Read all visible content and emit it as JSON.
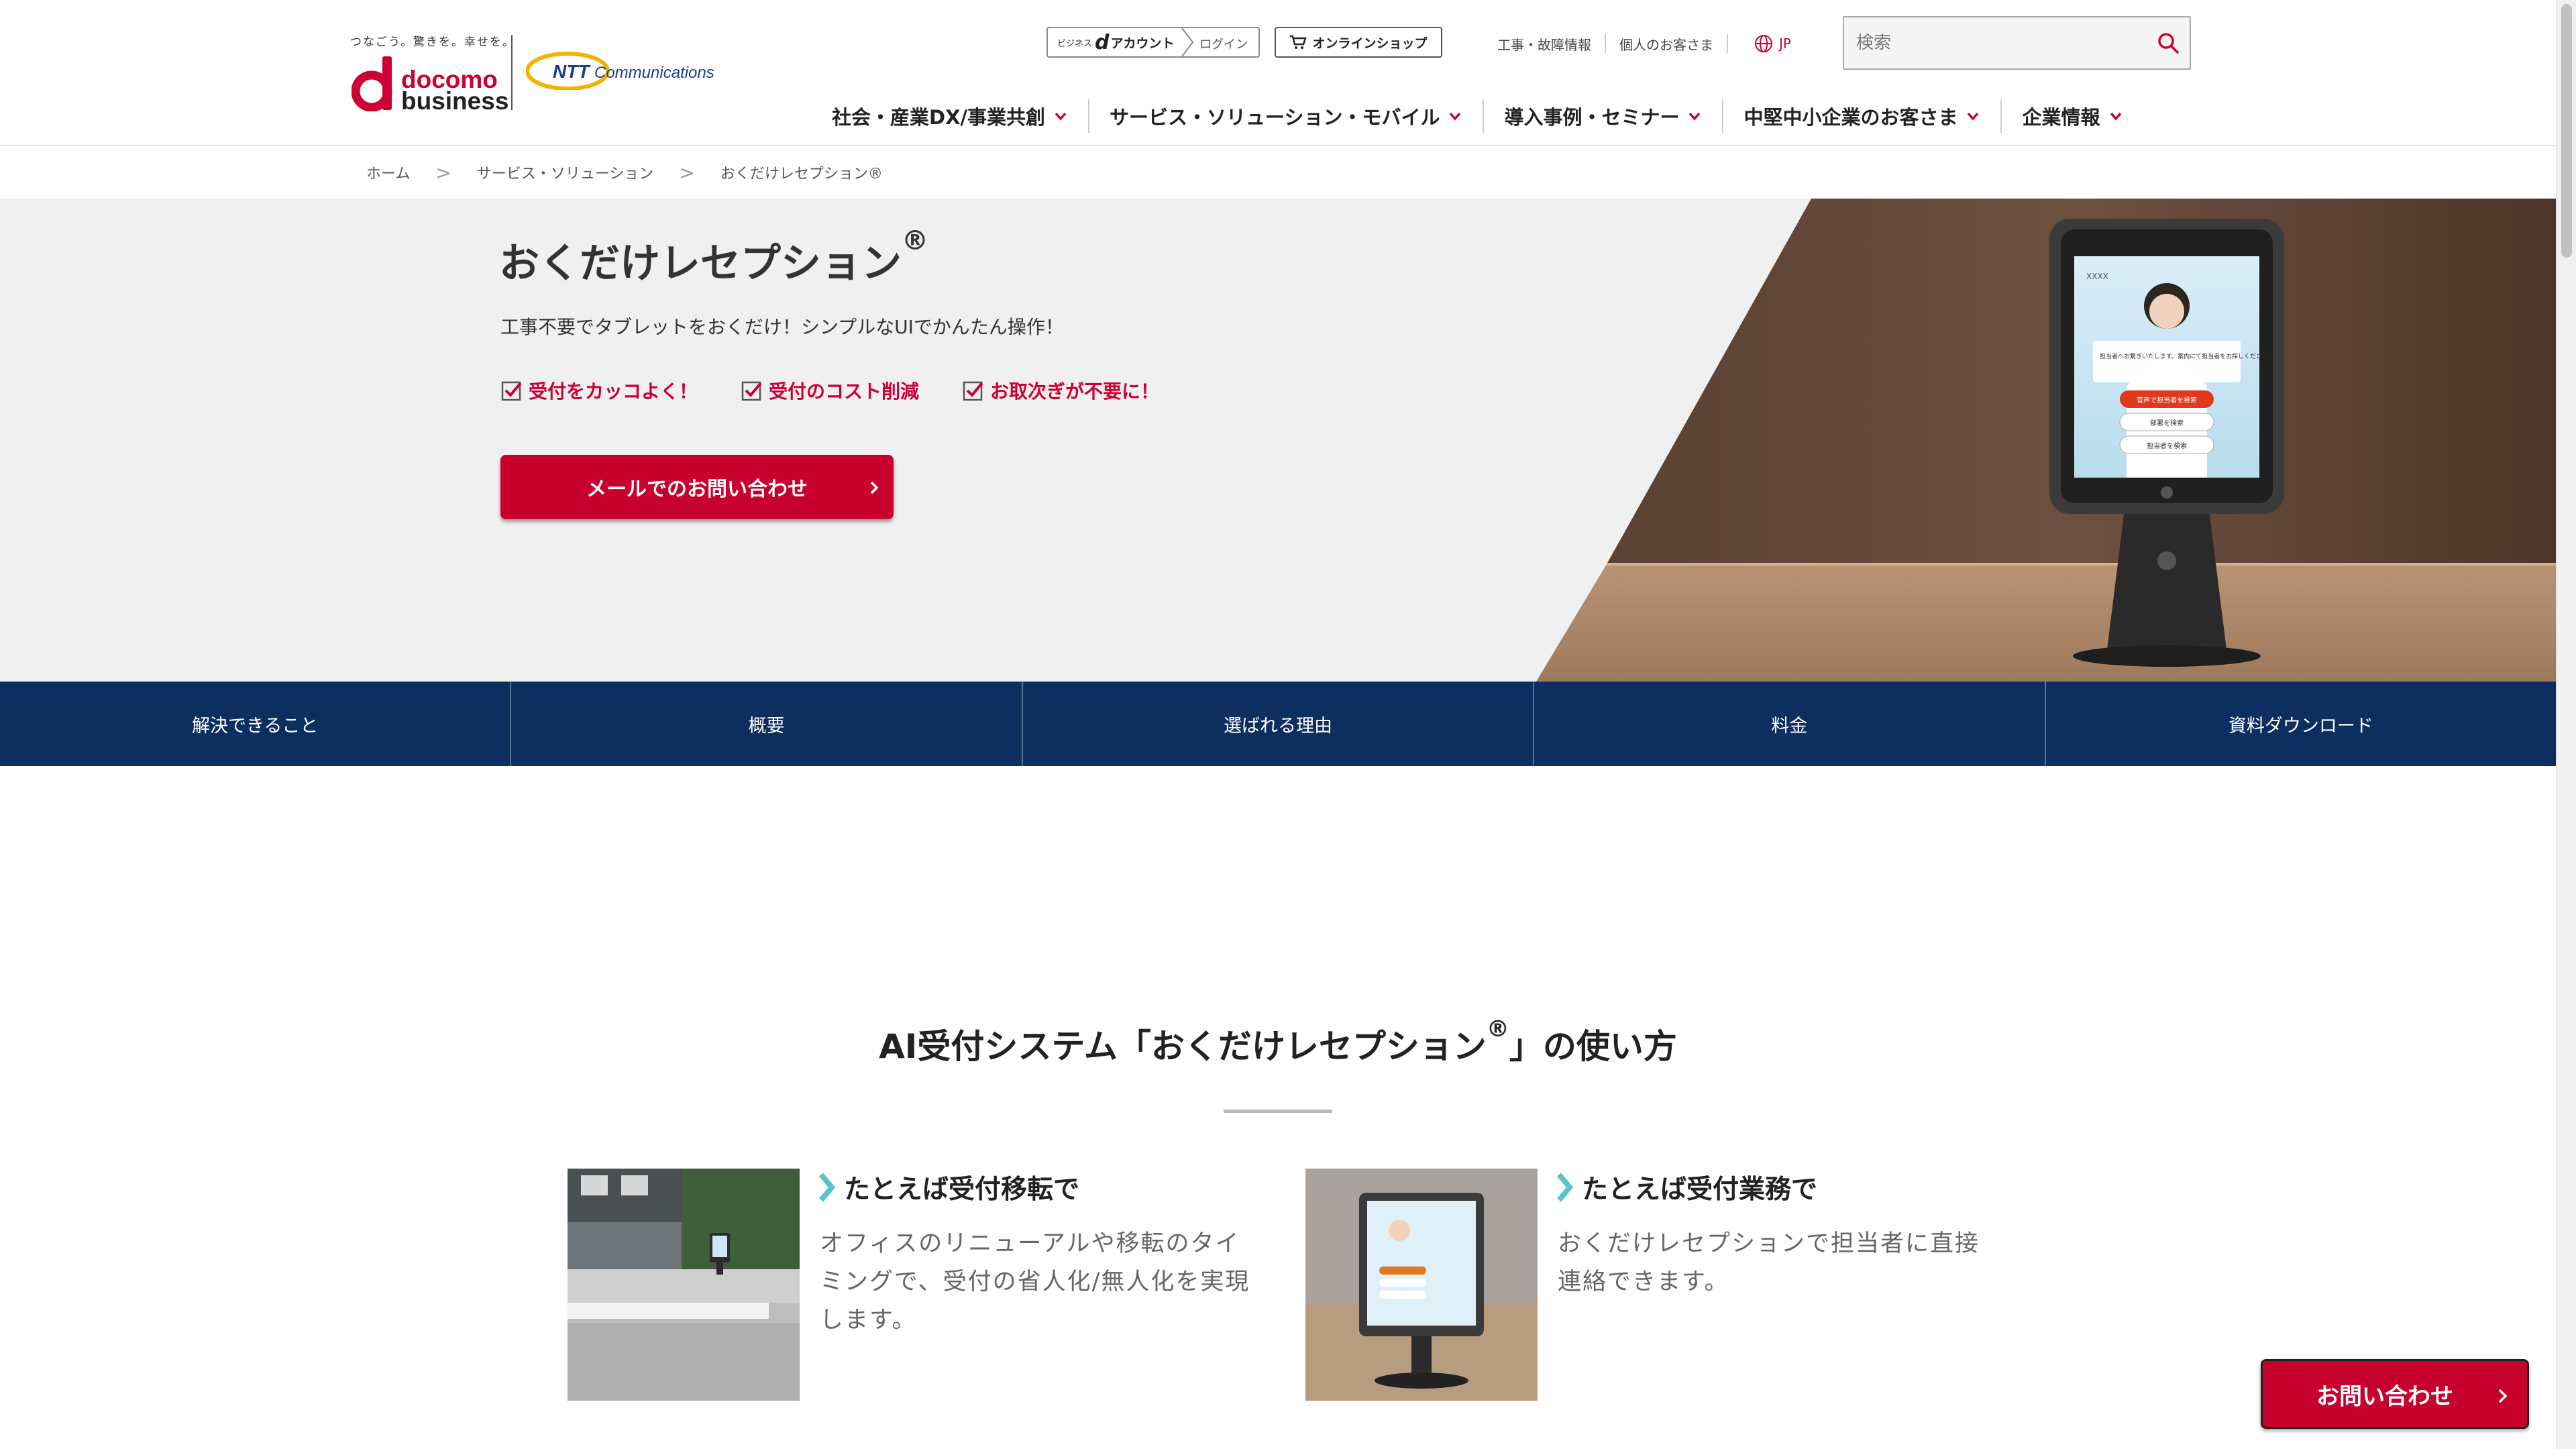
{
  "header": {
    "slogan": "つなごう。驚きを。幸せを。",
    "brand_primary": "docomo",
    "brand_secondary": "business",
    "ntt_brand": "NTT",
    "ntt_brand_sub": "Communications",
    "d_account": {
      "prefix": "ビジネス",
      "logo": "d",
      "label": "アカウント",
      "login": "ログイン"
    },
    "online_shop": "オンラインショップ",
    "util_links": [
      "工事・故障情報",
      "個人のお客さま"
    ],
    "language": "JP",
    "search": {
      "placeholder": "検索"
    },
    "nav": [
      "社会・産業DX/事業共創",
      "サービス・ソリューション・モバイル",
      "導入事例・セミナー",
      "中堅中小企業のお客さま",
      "企業情報"
    ]
  },
  "breadcrumb": [
    "ホーム",
    "サービス・ソリューション",
    "おくだけレセプション®"
  ],
  "breadcrumb_separator": ">",
  "hero": {
    "title": "おくだけレセプション",
    "title_mark": "®",
    "subtitle": "工事不要でタブレットをおくだけ！シンプルなUIでかんたん操作！",
    "features": [
      "受付をカッコよく！",
      "受付のコスト削減",
      "お取次ぎが不要に！"
    ],
    "cta": "メールでのお問い合わせ",
    "tablet_screen": {
      "header": "XXXX",
      "message": "担当者へお繋ぎいたします。案内にて担当者をお探しください。",
      "buttons": [
        "音声で担当者を検索",
        "部署を検索",
        "担当者を検索"
      ]
    }
  },
  "page_tabs": [
    "解決できること",
    "概要",
    "選ばれる理由",
    "料金",
    "資料ダウンロード"
  ],
  "section": {
    "title_prefix": "AI受付システム「おくだけレセプション",
    "title_mark": "®",
    "title_suffix": "」の使い方",
    "usecases": [
      {
        "heading": "たとえば受付移転で",
        "body": "オフィスのリニューアルや移転のタイミングで、受付の省人化/無人化を実現します。"
      },
      {
        "heading": "たとえば受付業務で",
        "body": "おくだけレセプションで担当者に直接連絡できます。"
      }
    ]
  },
  "floating_cta": "お問い合わせ",
  "colors": {
    "brand_red": "#c8002e",
    "nav_blue": "#0d2f5f",
    "accent_teal": "#5bc4c8",
    "hero_bg": "#f0f0f0"
  }
}
